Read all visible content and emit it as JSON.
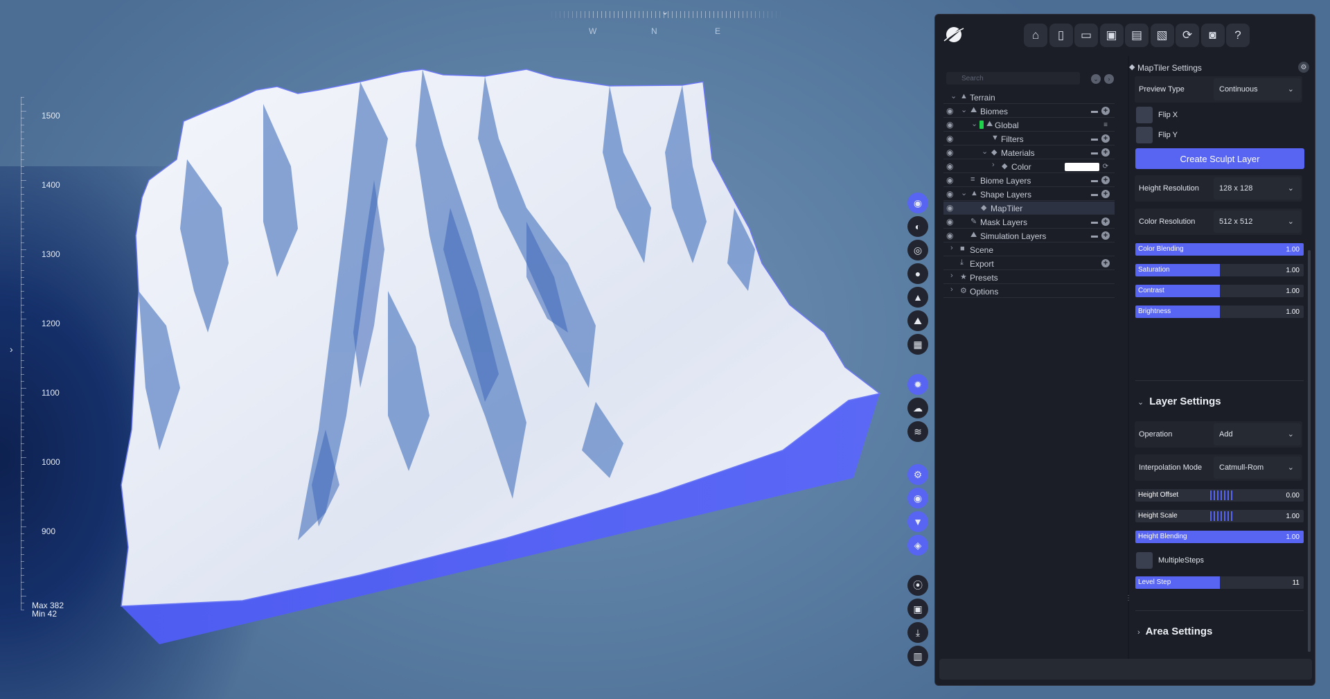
{
  "viewport": {
    "compass": {
      "west": "W",
      "north": "N",
      "east": "E"
    },
    "scale_labels": [
      "1500",
      "1400",
      "1300",
      "1200",
      "1100",
      "1000",
      "900"
    ],
    "max_label": "Max 382",
    "min_label": "Min 42",
    "terrain_side_color": "#5865f2"
  },
  "side_toolbar": {
    "buttons": [
      {
        "icon": "terrain-target-icon",
        "glyph": "◉",
        "active": true
      },
      {
        "icon": "globe-icon",
        "glyph": "◐",
        "active": false
      },
      {
        "icon": "settings-ring-icon",
        "glyph": "◎",
        "active": false
      },
      {
        "icon": "water-drop-icon",
        "glyph": "●",
        "active": false
      },
      {
        "icon": "mountain-icon",
        "glyph": "▲",
        "active": false
      },
      {
        "icon": "landscape-icon",
        "glyph": "⛰",
        "active": false
      },
      {
        "icon": "grid-icon",
        "glyph": "▦",
        "active": false
      },
      {
        "icon": "sun-icon",
        "glyph": "✹",
        "active": true
      },
      {
        "icon": "cloud-icon",
        "glyph": "☁",
        "active": false
      },
      {
        "icon": "fog-icon",
        "glyph": "≋",
        "active": false
      },
      {
        "icon": "gears-icon",
        "glyph": "⚙",
        "active": true
      },
      {
        "icon": "eye-icon",
        "glyph": "◉",
        "active": true
      },
      {
        "icon": "filter-icon",
        "glyph": "▼",
        "active": true
      },
      {
        "icon": "layers-icon",
        "glyph": "◈",
        "active": true
      },
      {
        "icon": "record-icon",
        "glyph": "⦿",
        "active": false
      },
      {
        "icon": "image-icon",
        "glyph": "▣",
        "active": false
      },
      {
        "icon": "download-icon",
        "glyph": "⤓",
        "active": false
      },
      {
        "icon": "stats-icon",
        "glyph": "▥",
        "active": false
      }
    ]
  },
  "header": {
    "buttons": [
      {
        "name": "home-button",
        "icon": "home-icon",
        "glyph": "⌂"
      },
      {
        "name": "new-file-button",
        "icon": "new-file-icon",
        "glyph": "▯"
      },
      {
        "name": "open-folder-button",
        "icon": "folder-open-icon",
        "glyph": "▭"
      },
      {
        "name": "save-button",
        "icon": "save-icon",
        "glyph": "▣"
      },
      {
        "name": "save-settings-button",
        "icon": "save-gear-icon",
        "glyph": "▤"
      },
      {
        "name": "save-as-button",
        "icon": "save-edit-icon",
        "glyph": "▧"
      },
      {
        "name": "refresh-button",
        "icon": "refresh-icon",
        "glyph": "⟳"
      },
      {
        "name": "screenshot-button",
        "icon": "camera-icon",
        "glyph": "◙"
      },
      {
        "name": "help-button",
        "icon": "help-icon",
        "glyph": "?"
      }
    ]
  },
  "tree": {
    "search_placeholder": "Search",
    "rows": [
      {
        "label": "Terrain",
        "icon": "terrain-icon",
        "glyph": "▲",
        "depth": 0,
        "expanded": true,
        "eye": false,
        "actions": []
      },
      {
        "label": "Biomes",
        "icon": "biomes-icon",
        "glyph": "⛰",
        "depth": 1,
        "expanded": true,
        "eye": true,
        "actions": [
          "folder",
          "plus"
        ]
      },
      {
        "label": "Global",
        "icon": "global-biome-icon",
        "glyph": "⛰",
        "depth": 2,
        "expanded": true,
        "eye": true,
        "green": true,
        "actions": [
          "stack"
        ]
      },
      {
        "label": "Filters",
        "icon": "filter-icon",
        "glyph": "▼",
        "depth": 3,
        "expanded": null,
        "eye": true,
        "actions": [
          "folder",
          "plus"
        ]
      },
      {
        "label": "Materials",
        "icon": "materials-icon",
        "glyph": "◆",
        "depth": 3,
        "expanded": true,
        "eye": true,
        "actions": [
          "folder",
          "plus"
        ]
      },
      {
        "label": "Color",
        "icon": "color-cube-icon",
        "glyph": "◆",
        "depth": 4,
        "expanded": false,
        "eye": true,
        "swatch": "#ffffff",
        "actions": [
          "refresh"
        ]
      },
      {
        "label": "Biome Layers",
        "icon": "biome-layers-icon",
        "glyph": "≡",
        "depth": 1,
        "expanded": null,
        "eye": true,
        "actions": [
          "folder",
          "plus"
        ]
      },
      {
        "label": "Shape Layers",
        "icon": "shape-layers-icon",
        "glyph": "▲",
        "depth": 1,
        "expanded": true,
        "eye": true,
        "actions": [
          "folder",
          "plus"
        ]
      },
      {
        "label": "MapTiler",
        "icon": "maptiler-pin-icon",
        "glyph": "◆",
        "depth": 2,
        "expanded": null,
        "eye": true,
        "selected": true,
        "actions": []
      },
      {
        "label": "Mask Layers",
        "icon": "brush-icon",
        "glyph": "✎",
        "depth": 1,
        "expanded": null,
        "eye": true,
        "actions": [
          "folder",
          "plus"
        ]
      },
      {
        "label": "Simulation Layers",
        "icon": "simulation-icon",
        "glyph": "⛰",
        "depth": 1,
        "expanded": null,
        "eye": true,
        "actions": [
          "folder",
          "plus"
        ]
      },
      {
        "label": "Scene",
        "icon": "camera-icon",
        "glyph": "■",
        "depth": 0,
        "expanded": false,
        "eye": false,
        "actions": []
      },
      {
        "label": "Export",
        "icon": "export-icon",
        "glyph": "⤓",
        "depth": 0,
        "expanded": null,
        "eye": false,
        "actions": [
          "plus"
        ]
      },
      {
        "label": "Presets",
        "icon": "star-icon",
        "glyph": "★",
        "depth": 0,
        "expanded": false,
        "eye": false,
        "actions": []
      },
      {
        "label": "Options",
        "icon": "gear-icon",
        "glyph": "⚙",
        "depth": 0,
        "expanded": false,
        "eye": false,
        "actions": []
      }
    ]
  },
  "settings": {
    "title": "MapTiler Settings",
    "preview_type": {
      "label": "Preview Type",
      "value": "Continuous"
    },
    "flip_x": {
      "label": "Flip X",
      "checked": false
    },
    "flip_y": {
      "label": "Flip Y",
      "checked": false
    },
    "create_button": "Create Sculpt Layer",
    "height_resolution": {
      "label": "Height Resolution",
      "value": "128 x 128"
    },
    "color_resolution": {
      "label": "Color Resolution",
      "value": "512 x 512"
    },
    "color_sliders": [
      {
        "label": "Color Blending",
        "value": "1.00",
        "fill": 1.0
      },
      {
        "label": "Saturation",
        "value": "1.00",
        "fill": 0.5
      },
      {
        "label": "Contrast",
        "value": "1.00",
        "fill": 0.5
      },
      {
        "label": "Brightness",
        "value": "1.00",
        "fill": 0.5
      }
    ],
    "layer_settings": {
      "heading": "Layer Settings",
      "operation": {
        "label": "Operation",
        "value": "Add"
      },
      "interpolation": {
        "label": "Interpolation Mode",
        "value": "Catmull-Rom"
      },
      "height_offset": {
        "label": "Height Offset",
        "value": "0.00"
      },
      "height_scale": {
        "label": "Height Scale",
        "value": "1.00"
      },
      "height_blending": {
        "label": "Height Blending",
        "value": "1.00",
        "fill": 1.0
      },
      "multiple_steps": {
        "label": "MultipleSteps",
        "checked": false
      },
      "level_step": {
        "label": "Level Step",
        "value": "11",
        "fill": 0.5
      }
    },
    "area_settings": {
      "heading": "Area Settings"
    }
  }
}
